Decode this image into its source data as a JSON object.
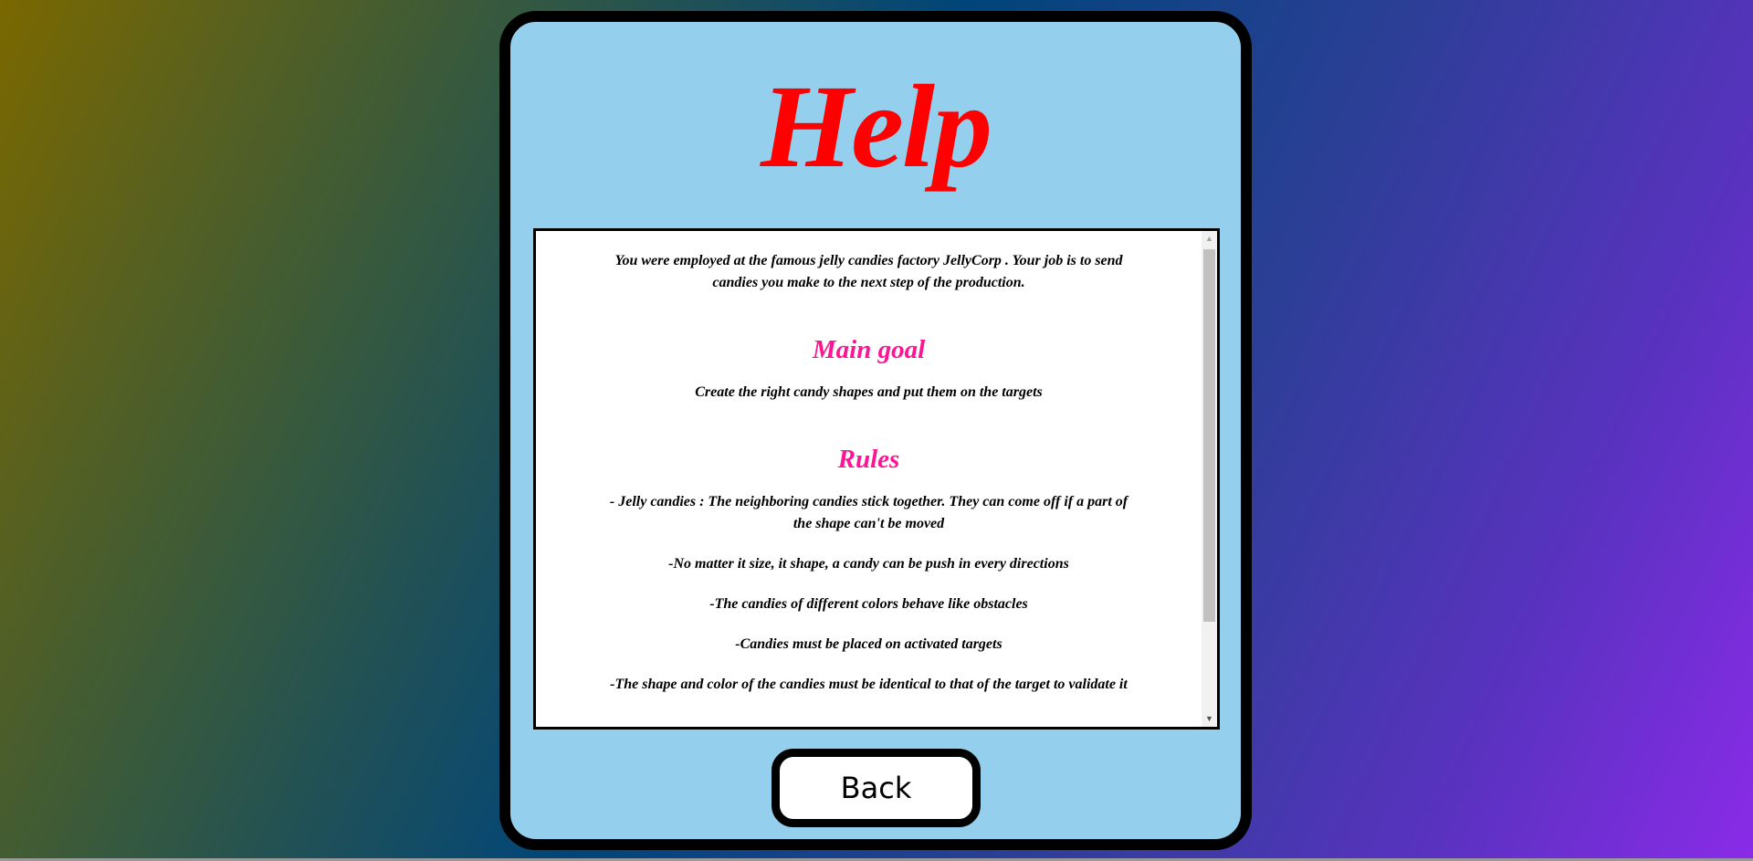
{
  "title": "Help",
  "colors": {
    "title": "#ff0000",
    "heading": "#ff1493",
    "panel": "#94d0ee"
  },
  "intro": "You were employed at the famous jelly candies factory JellyCorp . Your job is to send candies you make to the next step of the production.",
  "main_goal": {
    "heading": "Main goal",
    "text": "Create the right candy shapes and put them on the targets"
  },
  "rules": {
    "heading": "Rules",
    "items": [
      "- Jelly candies : The neighboring candies stick together. They can come off if a part of the shape can't be moved",
      "-No matter it size, it shape, a candy can be push in every directions",
      "-The candies of different colors behave like obstacles",
      "-Candies must be placed on activated targets",
      "-The shape and color of the candies must be identical to that of the target to validate it"
    ]
  },
  "back_label": "Back"
}
